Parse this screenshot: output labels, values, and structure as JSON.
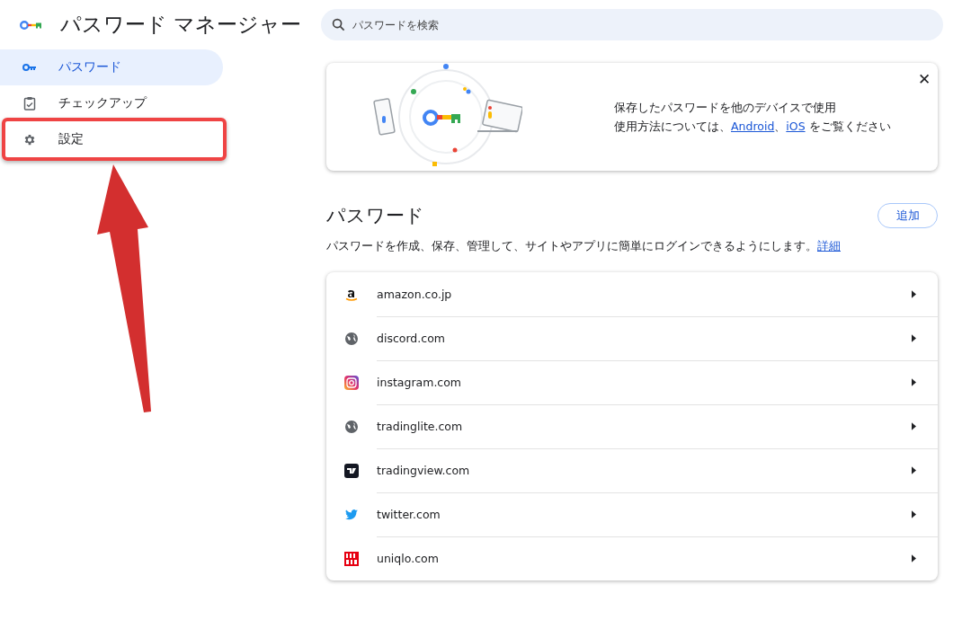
{
  "app_title": "パスワード マネージャー",
  "search": {
    "placeholder": "パスワードを検索"
  },
  "sidebar": {
    "items": [
      {
        "kind": "key",
        "label": "パスワード",
        "selected": true,
        "highlighted": false
      },
      {
        "kind": "checkup",
        "label": "チェックアップ",
        "selected": false,
        "highlighted": false
      },
      {
        "kind": "gear",
        "label": "設定",
        "selected": false,
        "highlighted": true
      }
    ]
  },
  "banner": {
    "line_1": "保存したパスワードを他のデバイスで使用",
    "line_2_before": "使用方法については、",
    "link_1": "Android",
    "separator": "、",
    "link_2": "iOS",
    "line_2_after": " をご覧ください",
    "close": "✕"
  },
  "section": {
    "title": "パスワード",
    "add_button": "追加",
    "description": "パスワードを作成、保存、管理して、サイトやアプリに簡単にログインできるようにします。",
    "details_link": "詳細"
  },
  "passwords": [
    {
      "kind": "amazon",
      "site": "amazon.co.jp"
    },
    {
      "kind": "globe",
      "site": "discord.com"
    },
    {
      "kind": "instagram",
      "site": "instagram.com"
    },
    {
      "kind": "globe",
      "site": "tradinglite.com"
    },
    {
      "kind": "tradingview",
      "site": "tradingview.com"
    },
    {
      "kind": "twitter",
      "site": "twitter.com"
    },
    {
      "kind": "uniqlo",
      "site": "uniqlo.com"
    }
  ]
}
